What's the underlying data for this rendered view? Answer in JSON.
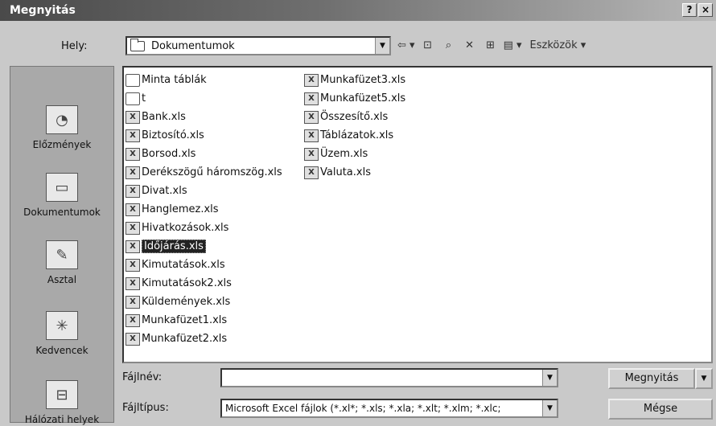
{
  "window": {
    "title": "Megnyitás",
    "help_glyph": "?",
    "close_glyph": "×"
  },
  "location": {
    "label": "Hely:",
    "value": "Dokumentumok"
  },
  "toolbar": {
    "tools_label": "Eszközök ▾",
    "icons": [
      "back-icon",
      "up-folder-icon",
      "search-web-icon",
      "delete-icon",
      "new-folder-icon",
      "views-icon"
    ]
  },
  "places": [
    {
      "label": "Előzmények",
      "icon": "history-icon"
    },
    {
      "label": "Dokumentumok",
      "icon": "documents-icon"
    },
    {
      "label": "Asztal",
      "icon": "desktop-icon"
    },
    {
      "label": "Kedvencek",
      "icon": "favorites-icon"
    },
    {
      "label": "Hálózati helyek",
      "icon": "network-icon"
    }
  ],
  "files": {
    "column1": [
      {
        "name": "Minta táblák",
        "type": "folder"
      },
      {
        "name": "t",
        "type": "folder"
      },
      {
        "name": "Bank.xls",
        "type": "xls"
      },
      {
        "name": "Biztosító.xls",
        "type": "xls"
      },
      {
        "name": "Borsod.xls",
        "type": "xls"
      },
      {
        "name": "Derékszögű háromszög.xls",
        "type": "xls"
      },
      {
        "name": "Divat.xls",
        "type": "xls"
      },
      {
        "name": "Hanglemez.xls",
        "type": "xls"
      },
      {
        "name": "Hivatkozások.xls",
        "type": "xls"
      },
      {
        "name": "Időjárás.xls",
        "type": "xls",
        "selected": true
      },
      {
        "name": "Kimutatások.xls",
        "type": "xls"
      },
      {
        "name": "Kimutatások2.xls",
        "type": "xls"
      },
      {
        "name": "Küldemények.xls",
        "type": "xls"
      },
      {
        "name": "Munkafüzet1.xls",
        "type": "xls"
      },
      {
        "name": "Munkafüzet2.xls",
        "type": "xls"
      }
    ],
    "column2": [
      {
        "name": "Munkafüzet3.xls",
        "type": "xls"
      },
      {
        "name": "Munkafüzet5.xls",
        "type": "xls"
      },
      {
        "name": "Összesítő.xls",
        "type": "xls"
      },
      {
        "name": "Táblázatok.xls",
        "type": "xls"
      },
      {
        "name": "Üzem.xls",
        "type": "xls"
      },
      {
        "name": "Valuta.xls",
        "type": "xls"
      }
    ]
  },
  "filename": {
    "label": "Fájlnév:",
    "value": ""
  },
  "filetype": {
    "label": "Fájltípus:",
    "value": "Microsoft Excel fájlok (*.xl*; *.xls; *.xla; *.xlt; *.xlm; *.xlc;"
  },
  "buttons": {
    "open": "Megnyitás",
    "cancel": "Mégse"
  }
}
